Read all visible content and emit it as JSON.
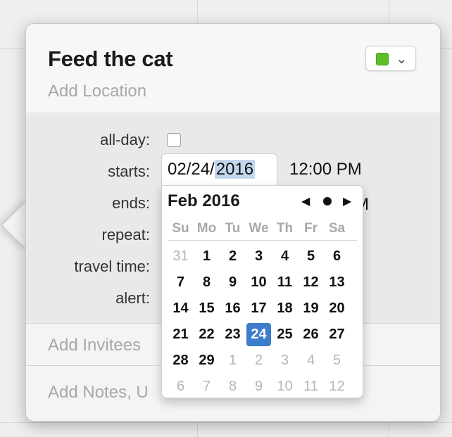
{
  "event": {
    "title": "Feed the cat",
    "location_placeholder": "Add Location",
    "color": "#5fbf2a",
    "color_dropdown_icon": "⌄"
  },
  "fields": {
    "all_day": "all-day:",
    "starts": "starts:",
    "ends": "ends:",
    "repeat": "repeat:",
    "travel_time": "travel time:",
    "alert": "alert:"
  },
  "start": {
    "date_prefix": "02/24/",
    "date_year": "2016",
    "time": "12:00 PM"
  },
  "end_time_tail": "M",
  "invitees_placeholder": "Add Invitees",
  "notes_placeholder": "Add Notes, U",
  "picker": {
    "month_label": "Feb 2016",
    "prev_icon": "◀",
    "next_icon": "▶",
    "weekdays": [
      "Su",
      "Mo",
      "Tu",
      "We",
      "Th",
      "Fr",
      "Sa"
    ],
    "weeks": [
      [
        "31",
        "1",
        "2",
        "3",
        "4",
        "5",
        "6"
      ],
      [
        "7",
        "8",
        "9",
        "10",
        "11",
        "12",
        "13"
      ],
      [
        "14",
        "15",
        "16",
        "17",
        "18",
        "19",
        "20"
      ],
      [
        "21",
        "22",
        "23",
        "24",
        "25",
        "26",
        "27"
      ],
      [
        "28",
        "29",
        "1",
        "2",
        "3",
        "4",
        "5"
      ],
      [
        "6",
        "7",
        "8",
        "9",
        "10",
        "11",
        "12"
      ]
    ],
    "selected_day": "24",
    "selected_color": "#3c7ecb"
  }
}
